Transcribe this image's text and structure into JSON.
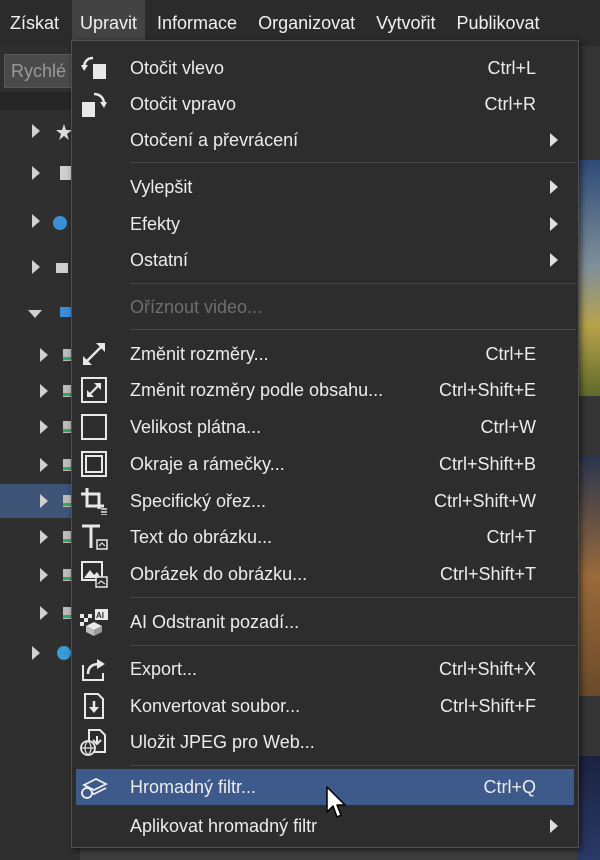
{
  "menubar": {
    "items": [
      "Získat",
      "Upravit",
      "Informace",
      "Organizovat",
      "Vytvořit",
      "Publikovat"
    ],
    "active_index": 1
  },
  "left_panel": {
    "search_placeholder": "Rychlé"
  },
  "menu": {
    "items": [
      {
        "label": "Otočit vlevo",
        "shortcut": "Ctrl+L",
        "icon": "rotate-left-icon"
      },
      {
        "label": "Otočit vpravo",
        "shortcut": "Ctrl+R",
        "icon": "rotate-right-icon"
      },
      {
        "label": "Otočení a převrácení",
        "submenu": true
      },
      {
        "label": "Vylepšit",
        "submenu": true
      },
      {
        "label": "Efekty",
        "submenu": true
      },
      {
        "label": "Ostatní",
        "submenu": true
      },
      {
        "label": "Oříznout video...",
        "disabled": true
      },
      {
        "label": "Změnit rozměry...",
        "shortcut": "Ctrl+E",
        "icon": "resize-icon"
      },
      {
        "label": "Změnit rozměry podle obsahu...",
        "shortcut": "Ctrl+Shift+E",
        "icon": "content-aware-resize-icon"
      },
      {
        "label": "Velikost plátna...",
        "shortcut": "Ctrl+W",
        "icon": "canvas-size-icon"
      },
      {
        "label": "Okraje a rámečky...",
        "shortcut": "Ctrl+Shift+B",
        "icon": "borders-frames-icon"
      },
      {
        "label": "Specifický ořez...",
        "shortcut": "Ctrl+Shift+W",
        "icon": "crop-icon"
      },
      {
        "label": "Text do obrázku...",
        "shortcut": "Ctrl+T",
        "icon": "text-icon"
      },
      {
        "label": "Obrázek do obrázku...",
        "shortcut": "Ctrl+Shift+T",
        "icon": "picture-in-picture-icon"
      },
      {
        "label": "AI Odstranit pozadí...",
        "icon": "ai-remove-background-icon"
      },
      {
        "label": "Export...",
        "shortcut": "Ctrl+Shift+X",
        "icon": "export-icon"
      },
      {
        "label": "Konvertovat soubor...",
        "shortcut": "Ctrl+Shift+F",
        "icon": "convert-file-icon"
      },
      {
        "label": "Uložit JPEG pro Web...",
        "icon": "save-jpeg-web-icon"
      },
      {
        "label": "Hromadný filtr...",
        "shortcut": "Ctrl+Q",
        "icon": "batch-filter-icon",
        "highlighted": true
      },
      {
        "label": "Aplikovat hromadný filtr",
        "submenu": true
      }
    ]
  },
  "colors": {
    "menu_bg": "#2d2d2d",
    "highlight": "#3d5a8a",
    "menubar_bg": "#2b2b2b",
    "text": "#ececec",
    "disabled_text": "#6e6e6e"
  }
}
